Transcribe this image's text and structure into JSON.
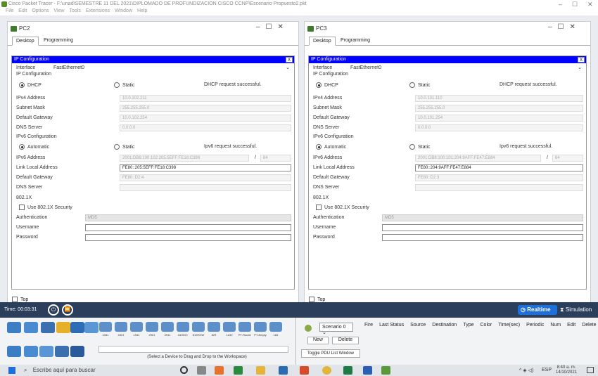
{
  "app": {
    "title": "Cisco Packet Tracer - F:\\unad\\SEMESTRE 11 DEL 2021\\DIPLOMADO DE PROFUNDIZACION CISCO CCNP\\Escenario Propuesto2.pkt",
    "menu": [
      "File",
      "Edit",
      "Options",
      "View",
      "Tools",
      "Extensions",
      "Window",
      "Help"
    ]
  },
  "windows": [
    {
      "title": "PC2",
      "tabs": [
        "Desktop",
        "Programming"
      ],
      "ip_config": {
        "header": "IP Configuration",
        "close": "X",
        "interface_label": "Interface",
        "interface_value": "FastEthernet0",
        "ipv4_section": "IP Configuration",
        "dhcp_label": "DHCP",
        "static_label": "Static",
        "dhcp_status": "DHCP request successful.",
        "ipv4_address_label": "IPv4 Address",
        "ipv4_address": "10.0.102.211",
        "subnet_label": "Subnet Mask",
        "subnet": "255.255.255.0",
        "gateway_label": "Default Gateway",
        "gateway": "10.0.102.254",
        "dns_label": "DNS Server",
        "dns": "0.0.0.0",
        "ipv6_section": "IPv6 Configuration",
        "auto_label": "Automatic",
        "static6_label": "Static",
        "ipv6_status": "Ipv6 request successful.",
        "ipv6_address_label": "IPv6 Address",
        "ipv6_address": "2001:DB8:100:102:205:5EFF:FE18:C398",
        "prefix_sep": "/",
        "prefix": "64",
        "link_local_label": "Link Local Address",
        "link_local": "FE80::205:5EFF:FE18:C398",
        "gw6_label": "Default Gateway",
        "gw6": "FE80::D2:4",
        "dns6_label": "DNS Server",
        "dns6": "",
        "dot1x_section": "802.1X",
        "use_dot1x": "Use 802.1X Security",
        "auth_label": "Authentication",
        "auth_value": "MD5",
        "user_label": "Username",
        "pass_label": "Password",
        "top_label": "Top"
      }
    },
    {
      "title": "PC3",
      "tabs": [
        "Desktop",
        "Programming"
      ],
      "ip_config": {
        "header": "IP Configuration",
        "close": "X",
        "interface_label": "Interface",
        "interface_value": "FastEthernet0",
        "ipv4_section": "IP Configuration",
        "dhcp_label": "DHCP",
        "static_label": "Static",
        "dhcp_status": "DHCP request successful.",
        "ipv4_address_label": "IPv4 Address",
        "ipv4_address": "10.0.101.110",
        "subnet_label": "Subnet Mask",
        "subnet": "255.255.255.0",
        "gateway_label": "Default Gateway",
        "gateway": "10.0.101.254",
        "dns_label": "DNS Server",
        "dns": "0.0.0.0",
        "ipv6_section": "IPv6 Configuration",
        "auto_label": "Automatic",
        "static6_label": "Static",
        "ipv6_status": "Ipv6 request successful.",
        "ipv6_address_label": "IPv6 Address",
        "ipv6_address": "2001:DB8:100:101:204:9AFF:FE47:E884",
        "prefix_sep": "/",
        "prefix": "64",
        "link_local_label": "Link Local Address",
        "link_local": "FE80::204:9AFF:FE47:E884",
        "gw6_label": "Default Gateway",
        "gw6": "FE80::D2:3",
        "dns6_label": "DNS Server",
        "dns6": "",
        "dot1x_section": "802.1X",
        "use_dot1x": "Use 802.1X Security",
        "auth_label": "Authentication",
        "auth_value": "MD5",
        "user_label": "Username",
        "pass_label": "Password",
        "top_label": "Top"
      }
    }
  ],
  "timebar": {
    "time": "Time: 00:03:31",
    "realtime": "Realtime",
    "simulation": "Simulation"
  },
  "bottom": {
    "device_models": [
      "4331",
      "4321",
      "1941",
      "2901",
      "2911",
      "819IOX",
      "819HGW",
      "829",
      "1240",
      "PT-Router",
      "PT-Empty",
      "184"
    ],
    "status": "(Select a Device to Drag and Drop to the Workspace)",
    "scenario": "Scenario 0",
    "new_btn": "New",
    "delete_btn": "Delete",
    "toggle_pdu": "Toggle PDU List Window",
    "pdu_columns": [
      "Fire",
      "Last Status",
      "Source",
      "Destination",
      "Type",
      "Color",
      "Time(sec)",
      "Periodic",
      "Num",
      "Edit",
      "Delete"
    ]
  },
  "taskbar": {
    "search": "Escribe aquí para buscar",
    "lang": "ESP",
    "clock_time": "8:40 a. m.",
    "clock_date": "14/10/2021"
  },
  "colors": {
    "ip_header": "#0000ff",
    "timebar": "#2b3e5c",
    "realtime": "#1e6fd9"
  }
}
